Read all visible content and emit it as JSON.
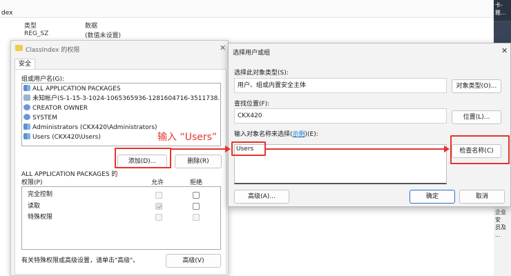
{
  "regedit": {
    "title_fragment": "dex",
    "col_type": "类型",
    "col_data": "数据",
    "row_type": "REG_SZ",
    "row_data": "(数值未设置)",
    "right_top": "卡-雅...",
    "right_bottom_1": "企业安",
    "right_bottom_2": "员及",
    "right_bottom_3": "..."
  },
  "perm_dialog": {
    "title": "ClassIndex 的权限",
    "tab": "安全",
    "group_label": "组或用户名(G):",
    "users": [
      {
        "name": "ALL APPLICATION PACKAGES",
        "icon": "group-icon"
      },
      {
        "name": "未知帐户(S-1-15-3-1024-1065365936-1281604716-3511738...",
        "icon": "unknown-account-icon"
      },
      {
        "name": "CREATOR OWNER",
        "icon": "user-icon"
      },
      {
        "name": "SYSTEM",
        "icon": "user-icon"
      },
      {
        "name": "Administrators (CKX420\\Administrators)",
        "icon": "group-icon"
      },
      {
        "name": "Users (CKX420\\Users)",
        "icon": "group-icon"
      }
    ],
    "add_button": "添加(D)...",
    "remove_button": "删除(R)",
    "perm_for_1": "ALL APPLICATION PACKAGES 的",
    "perm_for_2": "权限(P)",
    "allow_col": "允许",
    "deny_col": "拒绝",
    "permissions": [
      {
        "name": "完全控制",
        "allow": false,
        "deny": false
      },
      {
        "name": "读取",
        "allow": true,
        "deny": false
      },
      {
        "name": "特殊权限",
        "allow": false,
        "deny": false
      }
    ],
    "advanced_hint": "有关特殊权限或高级设置，请单击\"高级\"。",
    "advanced_button": "高级(V)"
  },
  "select_dialog": {
    "title": "选择用户或组",
    "object_type_label": "选择此对象类型(S):",
    "object_type_value": "用户、组或内置安全主体",
    "object_type_button": "对象类型(O)...",
    "location_label": "查找位置(F):",
    "location_value": "CKX420",
    "location_button": "位置(L)...",
    "names_label_prefix": "输入对象名称来选择(",
    "names_label_link": "示例",
    "names_label_suffix": ")(E):",
    "names_value": "Users",
    "check_names_button": "检查名称(C)",
    "advanced_button": "高级(A)...",
    "ok_button": "确定",
    "cancel_button": "取消"
  },
  "annotation": {
    "text": "输入 “Users”",
    "color": "#e8322b"
  }
}
